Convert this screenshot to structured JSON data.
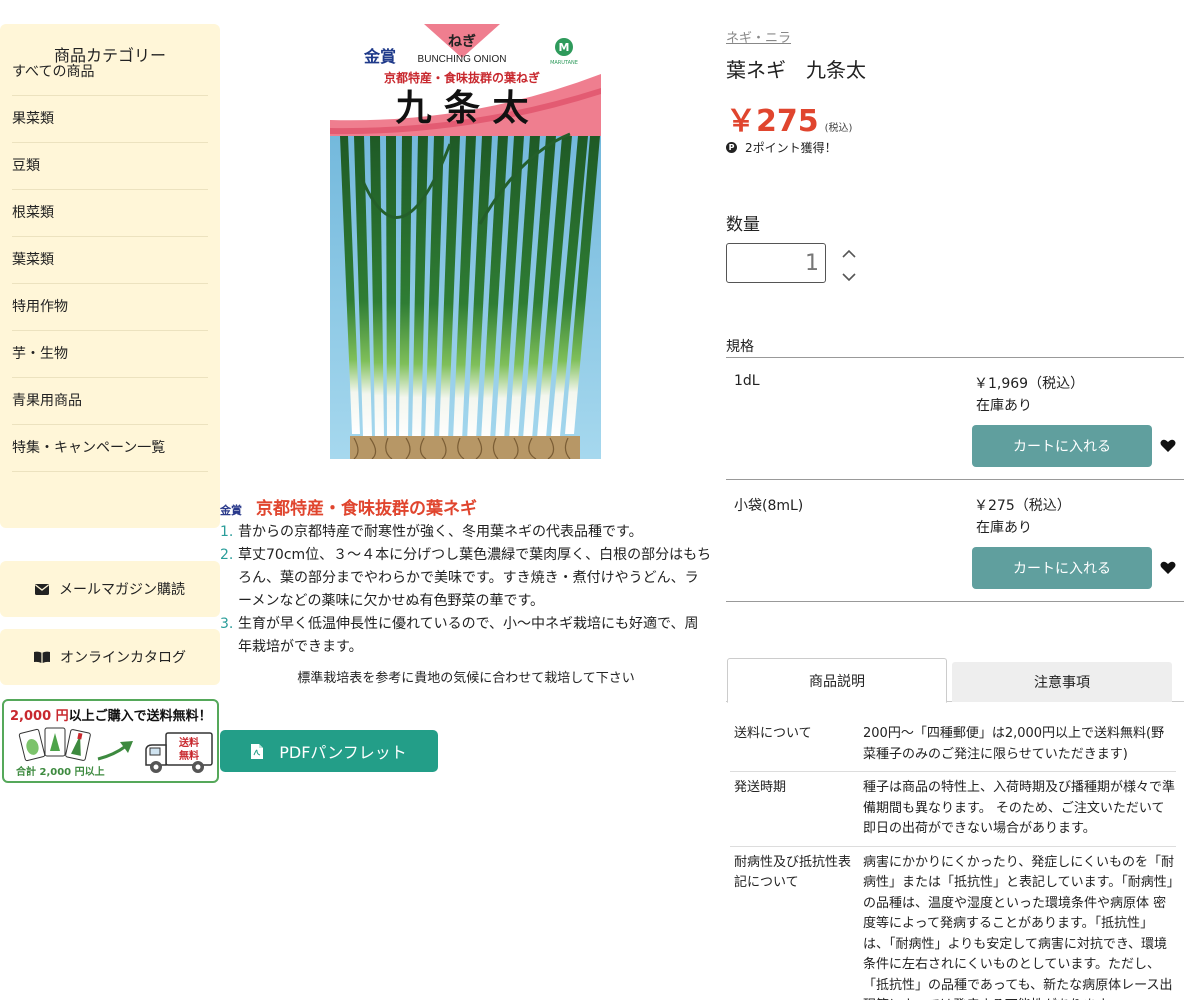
{
  "sidebar": {
    "title": "商品カテゴリー",
    "categories": [
      "すべての商品",
      "果菜類",
      "豆類",
      "根菜類",
      "葉菜類",
      "特用作物",
      "芋・生物",
      "青果用商品",
      "特集・キャンペーン一覧"
    ],
    "mail_magazine": "メールマガジン購読",
    "online_catalog": "オンラインカタログ",
    "banner": {
      "amount": "2,000 円",
      "headline_rest": "以上ご購入で送料無料！",
      "total_note": "合計 2,000 円以上",
      "free_shipping_line1": "送料",
      "free_shipping_line2": "無料"
    }
  },
  "package": {
    "award": "金賞",
    "crop_kana": "ねぎ",
    "crop_en": "BUNCHING ONION",
    "tagline": "京都特産・食味抜群の葉ねぎ",
    "variety": "九 条 太",
    "brand_mark": "M",
    "brand_text": "MARUTANE"
  },
  "description": {
    "award_tag": "金賞",
    "catchphrase": "京都特産・食味抜群の葉ネギ",
    "features": [
      {
        "num": "1.",
        "text": "昔からの京都特産で耐寒性が強く、冬用葉ネギの代表品種です。"
      },
      {
        "num": "2.",
        "text": "草丈70cm位、３～４本に分げつし葉色濃緑で葉肉厚く、白根の部分はもちろん、葉の部分までやわらかで美味です。すき焼き・煮付けやうどん、ラーメンなどの薬味に欠かせぬ有色野菜の華です。"
      },
      {
        "num": "3.",
        "text": "生育が早く低温伸長性に優れているので、小～中ネギ栽培にも好適で、周年栽培ができます。"
      }
    ],
    "cultivation_note": "標準栽培表を参考に貴地の気候に合わせて栽培して下さい",
    "pdf_button": "PDFパンフレット"
  },
  "product": {
    "breadcrumb": "ネギ・ニラ",
    "title": "葉ネギ　九条太",
    "price": "￥275",
    "tax_note": "(税込)",
    "points": "2ポイント獲得！",
    "quantity_label": "数量",
    "quantity_value": "1",
    "spec_label": "規格",
    "variants": [
      {
        "name": "1dL",
        "price": "￥1,969（税込）",
        "stock": "在庫あり",
        "cart": "カートに入れる"
      },
      {
        "name": "小袋(8mL)",
        "price": "￥275（税込）",
        "stock": "在庫あり",
        "cart": "カートに入れる"
      }
    ]
  },
  "tabs": {
    "description": "商品説明",
    "notes": "注意事項"
  },
  "info": [
    {
      "key": "送料について",
      "value": "200円～「四種郵便」は2,000円以上で送料無料(野菜種子のみのご発注に限らせていただきます)"
    },
    {
      "key": "発送時期",
      "value": "種子は商品の特性上、入荷時期及び播種期が様々で準備期間も異なります。 そのため、ご注文いただいて即日の出荷ができない場合があります。"
    },
    {
      "key": "耐病性及び抵抗性表記について",
      "value": "病害にかかりにくかったり、発症しにくいものを「耐病性」または「抵抗性」と表記しています。「耐病性」の品種は、温度や湿度といった環境条件や病原体 密度等によって発病することがあります。「抵抗性」は、「耐病性」よりも安定して病害に対抗でき、環境条件に左右されにくいものとしています。ただし、「抵抗性」の品種であっても、新たな病原体レース出現等によっては発病する可能性があります。"
    }
  ]
}
